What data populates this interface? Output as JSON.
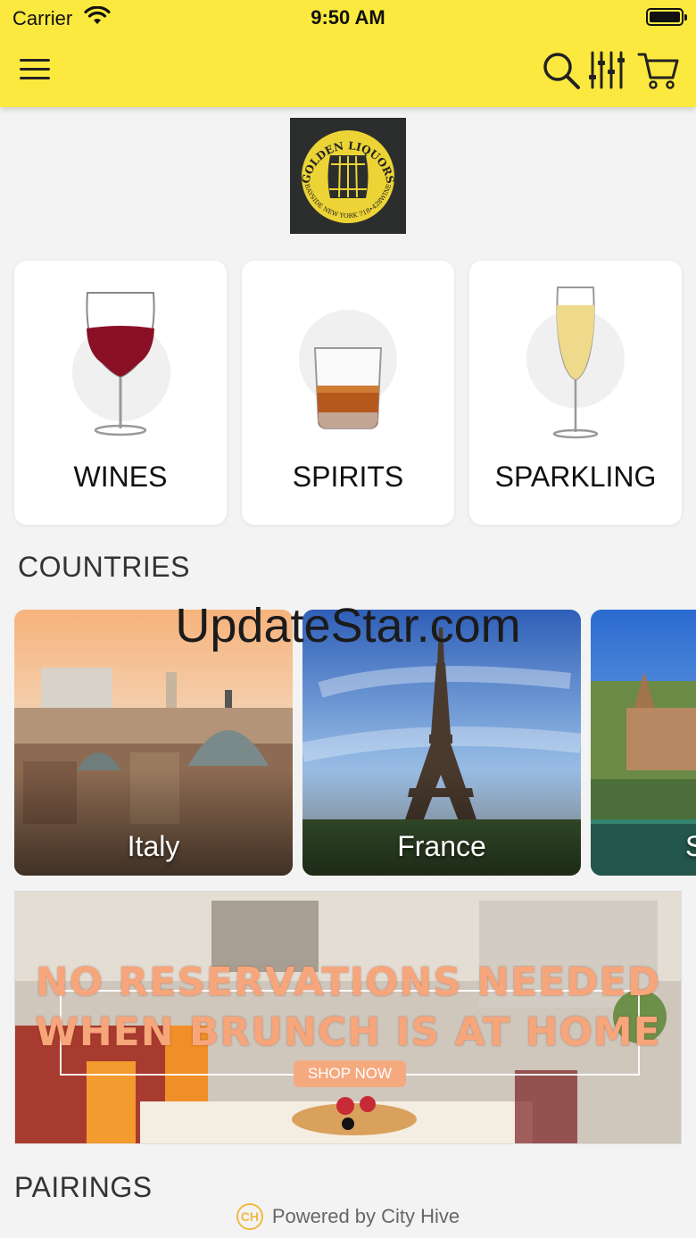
{
  "status_bar": {
    "carrier": "Carrier",
    "time": "9:50 AM"
  },
  "header": {
    "icons": [
      "menu-icon",
      "search-icon",
      "filter-icon",
      "cart-icon"
    ],
    "accent_color": "#fce93f"
  },
  "logo": {
    "text_top": "GOLDEN LIQUORS",
    "text_bottom": "BAYSIDE NEW YORK 718•428WINE"
  },
  "categories": [
    {
      "label": "WINES",
      "icon": "red-wine-glass-icon"
    },
    {
      "label": "SPIRITS",
      "icon": "whiskey-glass-icon"
    },
    {
      "label": "SPARKLING",
      "icon": "champagne-flute-icon"
    }
  ],
  "countries_section": {
    "title": "COUNTRIES"
  },
  "countries": [
    {
      "name": "Italy"
    },
    {
      "name": "France"
    },
    {
      "name": "S"
    }
  ],
  "watermark": "UpdateStar.com",
  "banner": {
    "line1": "NO RESERVATIONS NEEDED",
    "line2": "WHEN BRUNCH IS AT HOME",
    "button": "SHOP NOW"
  },
  "pairings_section": {
    "title": "PAIRINGS"
  },
  "footer": {
    "logo_text": "CH",
    "text": "Powered by City Hive"
  }
}
